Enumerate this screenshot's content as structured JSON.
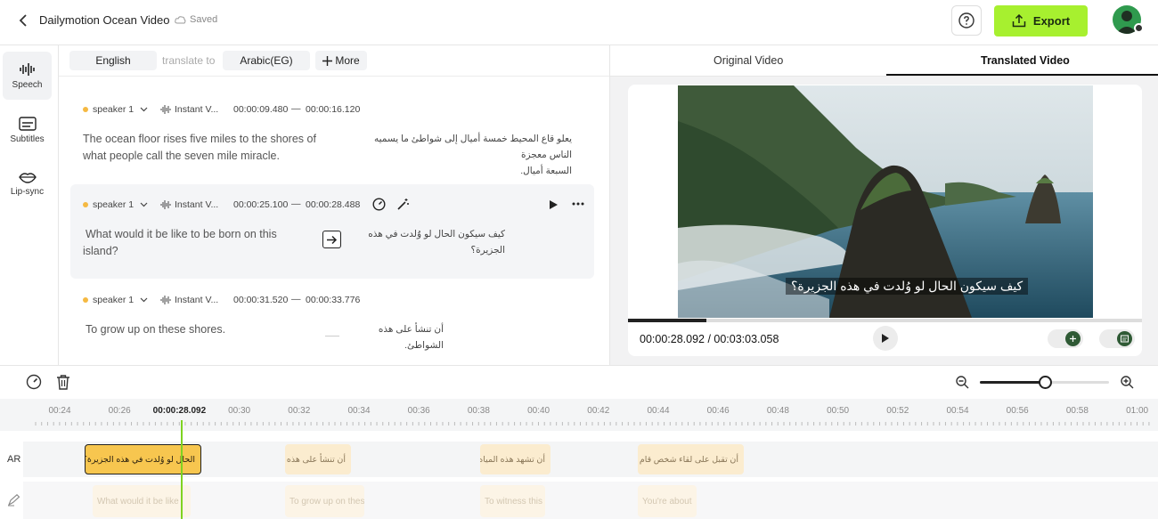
{
  "header": {
    "title": "Dailymotion Ocean Video",
    "saved_label": "Saved",
    "export_label": "Export"
  },
  "rail": [
    {
      "label": "Speech",
      "icon": "speech-waveform-icon"
    },
    {
      "label": "Subtitles",
      "icon": "subtitles-icon"
    },
    {
      "label": "Lip-sync",
      "icon": "lip-sync-icon"
    }
  ],
  "langbar": {
    "source": "English",
    "translate_to": "translate to",
    "target": "Arabic(EG)",
    "more": "More"
  },
  "segments": [
    {
      "speaker": "speaker 1",
      "voice": "Instant V...",
      "start": "00:00:09.480",
      "dash": "—",
      "end": "00:00:16.120",
      "source_lines": [
        "The ocean floor rises five miles to the shores of",
        "what people call the seven mile miracle."
      ],
      "target_lines": [
        "يعلو قاع المحيط خمسة أميال إلى شواطئ ما يسميه الناس معجزة",
        "السبعة أميال."
      ]
    },
    {
      "speaker": "speaker 1",
      "voice": "Instant V...",
      "start": "00:00:25.100",
      "dash": "—",
      "end": "00:00:28.488",
      "source_lines": [
        "What would it be like to be born on this",
        "island?"
      ],
      "target_lines": [
        "كيف سيكون الحال لو وُلدت في هذه الجزيرة؟"
      ]
    },
    {
      "speaker": "speaker 1",
      "voice": "Instant V...",
      "start": "00:00:31.520",
      "dash": "—",
      "end": "00:00:33.776",
      "source_lines": [
        "To grow up on these shores."
      ],
      "target_lines": [
        "أن تنشأ على هذه الشواطئ."
      ]
    }
  ],
  "video": {
    "tab_original": "Original Video",
    "tab_translated": "Translated Video",
    "caption": "كيف سيكون الحال لو وُلدت في هذه الجزيرة؟",
    "time": "00:00:28.092 / 00:03:03.058",
    "progress": 0.153
  },
  "timeline": {
    "ticks": [
      "00:24",
      "00:26",
      "00:00:28.092",
      "00:30",
      "00:32",
      "00:34",
      "00:36",
      "00:38",
      "00:40",
      "00:42",
      "00:44",
      "00:46",
      "00:48",
      "00:50",
      "00:52",
      "00:54",
      "00:56",
      "00:58",
      "01:00"
    ],
    "track_ar_label": "AR",
    "zoom_level": 0.5,
    "ar_clips": [
      "الحال لو وُلدت في هذه الجزيرة؟",
      "أن تنشأ على هذه الشواطئ",
      "أن تشهد هذه المياه كل يوم",
      "أن تقبل على لقاء شخص قام بذلك"
    ],
    "en_clips": [
      "What would it be like",
      "To grow up on these",
      "To witness this",
      "You're about"
    ]
  },
  "colors": {
    "accent": "#a7f02f",
    "speaker_dot": "#f5b942",
    "playhead": "#7ed321",
    "clip_selected": "#f7c64f"
  }
}
